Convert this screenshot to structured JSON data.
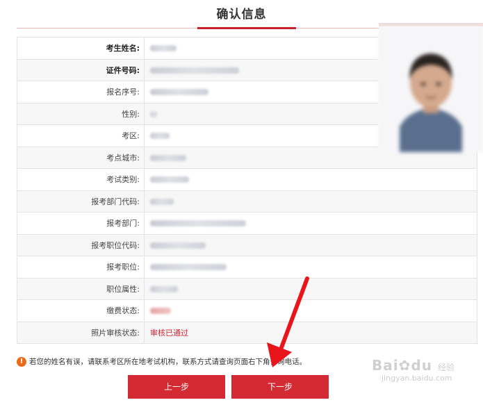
{
  "page": {
    "title": "确认信息"
  },
  "fields": [
    {
      "label": "考生姓名:"
    },
    {
      "label": "证件号码:"
    },
    {
      "label": "报名序号:"
    },
    {
      "label": "性别:"
    },
    {
      "label": "考区:"
    },
    {
      "label": "考点城市:"
    },
    {
      "label": "考试类别:"
    },
    {
      "label": "报考部门代码:"
    },
    {
      "label": "报考部门:"
    },
    {
      "label": "报考职位代码:"
    },
    {
      "label": "报考职位:"
    },
    {
      "label": "职位属性:"
    },
    {
      "label": "缴费状态:"
    },
    {
      "label": "照片审核状态:",
      "value": "审核已通过"
    }
  ],
  "notice": {
    "icon": "info-icon",
    "text": "若您的姓名有误，请联系考区所在地考试机构，联系方式请查询页面右下角咨询电话。"
  },
  "buttons": {
    "prev_label": "上一步",
    "next_label": "下一步"
  },
  "watermark": {
    "brand": "Bai",
    "brand_tail": "du",
    "sub": "经验",
    "url": "jingyan.baidu.com"
  },
  "colors": {
    "accent": "#d42a33",
    "status_text": "#d9232d",
    "notice_icon": "#ee6a1a"
  }
}
